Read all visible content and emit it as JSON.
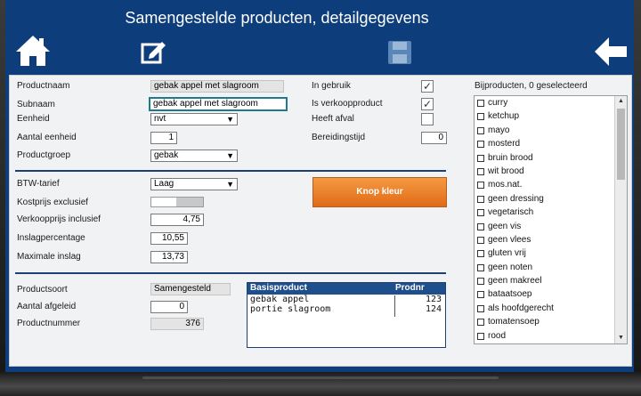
{
  "window": {
    "title": "Samengestelde producten, detailgegevens"
  },
  "nav": {
    "home_icon": "home-icon",
    "edit_icon": "edit-icon",
    "save_icon": "save-icon",
    "back_icon": "back-arrow-icon"
  },
  "form": {
    "productnaam_label": "Productnaam",
    "productnaam_value": "gebak appel met slagroom",
    "subnaam_label": "Subnaam",
    "subnaam_value": "gebak appel met slagroom",
    "eenheid_label": "Eenheid",
    "eenheid_value": "nvt",
    "aantal_eenheid_label": "Aantal eenheid",
    "aantal_eenheid_value": "1",
    "productgroep_label": "Productgroep",
    "productgroep_value": "gebak",
    "in_gebruik_label": "In gebruik",
    "in_gebruik_checked": "✓",
    "verkoopproduct_label": "Is verkoopproduct",
    "verkoopproduct_checked": "✓",
    "heeft_afval_label": "Heeft afval",
    "bereidingstijd_label": "Bereidingstijd",
    "bereidingstijd_value": "0",
    "btw_label": "BTW-tarief",
    "btw_value": "Laag",
    "kostprijs_label": "Kostprijs exclusief",
    "verkoopprijs_label": "Verkoopprijs inclusief",
    "verkoopprijs_value": "4,75",
    "inslag_label": "Inslagpercentage",
    "inslag_value": "10,55",
    "max_inslag_label": "Maximale inslag",
    "max_inslag_value": "13,73",
    "knop_kleur_label": "Knop kleur",
    "productsoort_label": "Productsoort",
    "productsoort_value": "Samengesteld",
    "aantal_afgeleid_label": "Aantal afgeleid",
    "aantal_afgeleid_value": "0",
    "productnummer_label": "Productnummer",
    "productnummer_value": "376"
  },
  "basis_table": {
    "col_product": "Basisproduct",
    "col_prodnr": "Prodnr",
    "rows": [
      {
        "product": "gebak appel",
        "prodnr": "123"
      },
      {
        "product": "portie slagroom",
        "prodnr": "124"
      }
    ]
  },
  "bijproducten": {
    "header": "Bijproducten, 0 geselecteerd",
    "items": [
      "curry",
      "ketchup",
      "mayo",
      "mosterd",
      "bruin brood",
      "wit brood",
      "mos.nat.",
      "geen dressing",
      "vegetarisch",
      "geen vis",
      "geen vlees",
      "gluten vrij",
      "geen noten",
      "geen makreel",
      "bataatsoep",
      "als hoofdgerecht",
      "tomatensoep",
      "rood"
    ]
  },
  "colors": {
    "header_bg": "#0d3d7a",
    "accent_orange": "#f08a30",
    "table_header": "#1e4e8c"
  }
}
